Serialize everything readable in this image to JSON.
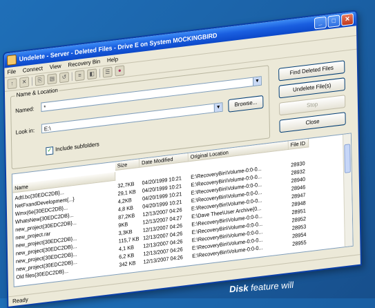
{
  "window": {
    "title": "Undelete - Server - Deleted Files - Drive E on System MOCKINGBIRD",
    "min": "_",
    "max": "□",
    "close": "✕"
  },
  "menu": [
    "File",
    "Connect",
    "View",
    "Recovery Bin",
    "Help"
  ],
  "search": {
    "group_title": "Name & Location",
    "named_label": "Named:",
    "named_value": "*",
    "lookin_label": "Look in:",
    "lookin_value": "E:\\",
    "browse": "Browse...",
    "include_subfolders": "Include subfolders"
  },
  "buttons": {
    "find": "Find Deleted Files",
    "undelete": "Undelete File(s)",
    "stop": "Stop",
    "close": "Close"
  },
  "table": {
    "columns": [
      "Name",
      "Size",
      "Date Modified",
      "Original Location",
      "File ID"
    ],
    "rows": [
      {
        "name": "Adtl.bc{30EDC2DB}...",
        "size": "32,7KB",
        "date": "04/20/1999 10:21",
        "loc": "E:\\RecoveryBin\\Volume-0:0-0...",
        "id": "28930"
      },
      {
        "name": "NetFxandDevelopment{...}",
        "size": "29,1 KB",
        "date": "04/20/1999 10:21",
        "loc": "E:\\RecoveryBin\\Volume-0:0-0...",
        "id": "28932"
      },
      {
        "name": "Wmx(6e{30EDC2DB}...",
        "size": "4,2KB",
        "date": "04/20/1999 10:21",
        "loc": "E:\\RecoveryBin\\Volume-0:0-0...",
        "id": "28940"
      },
      {
        "name": "WhatsNew{30EDC2DB}...",
        "size": "4,8 KB",
        "date": "04/20/1999 10:21",
        "loc": "E:\\RecoveryBin\\Volume-0:0-0...",
        "id": "28946"
      },
      {
        "name": "new_project{30EDC2DB}...",
        "size": "87,2KB",
        "date": "12/13/2007 04:26",
        "loc": "E:\\RecoveryBin\\Volume-0:0-0...",
        "id": "28947"
      },
      {
        "name": "new_project.rar",
        "size": "9KB",
        "date": "12/13/2007 04:27",
        "loc": "E:\\Dave Thee\\User Archive{0...",
        "id": "28948"
      },
      {
        "name": "new_project{30EDC2DB}...",
        "size": "3,3KB",
        "date": "12/13/2007 04:26",
        "loc": "E:\\RecoveryBin\\Volume-0:0-0...",
        "id": "28951"
      },
      {
        "name": "new_project{30EDC2DB}...",
        "size": "115,7 KB",
        "date": "12/13/2007 04:26",
        "loc": "E:\\RecoveryBin\\Volume-0:0-0...",
        "id": "28952"
      },
      {
        "name": "new_project{30EDC2DB}...",
        "size": "4,1 KB",
        "date": "12/13/2007 04:26",
        "loc": "E:\\RecoveryBin\\Volume-0:0-0...",
        "id": "28953"
      },
      {
        "name": "new_project{30EDC2DB}...",
        "size": "6,2 KB",
        "date": "12/13/2007 04:26",
        "loc": "E:\\RecoveryBin\\Volume-0:0-0...",
        "id": "28954"
      },
      {
        "name": "Old files{30EDC2DB}...",
        "size": "342 KB",
        "date": "12/13/2007 04:26",
        "loc": "E:\\RecoveryBin\\Volume-0:0-0...",
        "id": "28955"
      }
    ]
  },
  "status": "Ready",
  "caption": {
    "bold": "Disk",
    "rest": " feature will"
  },
  "colors": {
    "background": "#1f6fb8",
    "titlebar": "#1a5fe0"
  }
}
